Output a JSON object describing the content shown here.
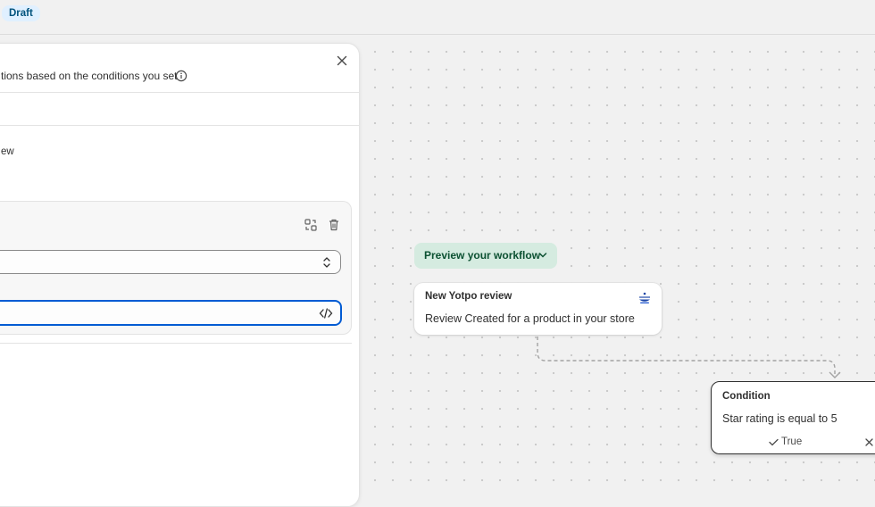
{
  "topbar": {
    "status_badge": "Draft"
  },
  "panel": {
    "description": "tions based on the conditions you set",
    "trigger_text": "ew"
  },
  "workflow": {
    "preview_label": "Preview your workflow",
    "trigger_node": {
      "title": "New Yotpo review",
      "body": "Review Created for a product in your store"
    },
    "condition_node": {
      "title": "Condition",
      "body": "Star rating is equal to 5",
      "true_label": "True"
    }
  },
  "colors": {
    "accent_focus": "#005bd3",
    "preview_bg": "#d5ebe0",
    "badge_bg": "#e0f0ff"
  }
}
